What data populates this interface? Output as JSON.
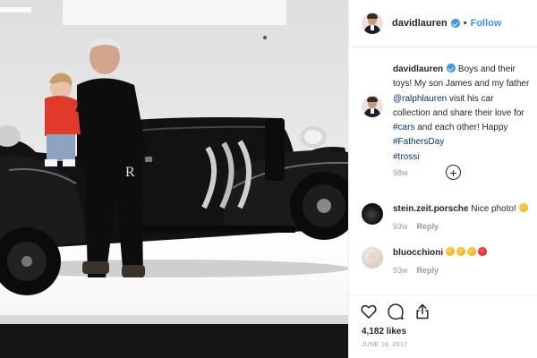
{
  "post": {
    "username": "davidlauren",
    "follow_label": "Follow",
    "separator": "•",
    "caption": {
      "text_before": " Boys and their toys! My son James and my father ",
      "mention": "@ralphlauren",
      "text_mid": " visit his car collection and share their love for ",
      "tag_cars": "#cars",
      "text_after": " and each other! Happy ",
      "tag_fathers": "#FathersDay",
      "tag_trossi": "#trossi",
      "time": "98w"
    },
    "load_more": "+",
    "comments": [
      {
        "user": "stein.zeit.porsche",
        "text": " Nice photo! ",
        "time": "93w",
        "reply": "Reply"
      },
      {
        "user": "bluocchioni",
        "text": " ",
        "time": "93w",
        "reply": "Reply"
      }
    ],
    "likes": "4,182 likes",
    "date": "JUNE 18, 2017"
  },
  "colors": {
    "accent": "#3897f0",
    "text": "#262626",
    "muted": "#999999",
    "link": "#003569"
  },
  "icons": [
    "heart-icon",
    "comment-icon",
    "share-icon",
    "verified-icon",
    "plus-circle-icon"
  ]
}
